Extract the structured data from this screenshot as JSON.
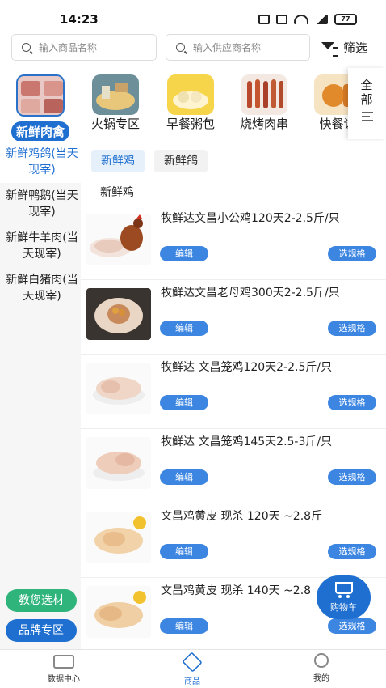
{
  "status_bar": {
    "time": "14:23",
    "battery": "77",
    "icons": [
      "nfc-icon",
      "hd-icon",
      "wifi-icon",
      "signal-icon",
      "battery-icon"
    ]
  },
  "search": {
    "goods_placeholder": "输入商品名称",
    "supplier_placeholder": "输入供应商名称",
    "filter_label": "筛选"
  },
  "categories": [
    {
      "label": "新鲜肉禽",
      "active": true
    },
    {
      "label": "火锅专区",
      "active": false
    },
    {
      "label": "早餐粥包",
      "active": false
    },
    {
      "label": "烧烤肉串",
      "active": false
    },
    {
      "label": "快餐诉",
      "active": false
    }
  ],
  "category_all_label": "全部",
  "sidebar": {
    "items": [
      {
        "label": "新鲜鸡鸽(当天现宰)",
        "active": true
      },
      {
        "label": "新鲜鸭鹅(当天现宰)",
        "active": false
      },
      {
        "label": "新鲜牛羊肉(当天现宰)",
        "active": false
      },
      {
        "label": "新鲜白猪肉(当天现宰)",
        "active": false
      }
    ],
    "guide_button": "教您选材",
    "brand_button": "品牌专区"
  },
  "sub_tabs": [
    {
      "label": "新鲜鸡",
      "active": true
    },
    {
      "label": "新鲜鸽",
      "active": false
    }
  ],
  "section_title": "新鲜鸡",
  "products": [
    {
      "name": "牧鲜达文昌小公鸡120天2-2.5斤/只",
      "edit": "编辑",
      "spec": "选规格"
    },
    {
      "name": "牧鲜达文昌老母鸡300天2-2.5斤/只",
      "edit": "编辑",
      "spec": "选规格"
    },
    {
      "name": "牧鲜达 文昌笼鸡120天2-2.5斤/只",
      "edit": "编辑",
      "spec": "选规格"
    },
    {
      "name": "牧鲜达 文昌笼鸡145天2.5-3斤/只",
      "edit": "编辑",
      "spec": "选规格"
    },
    {
      "name": "文昌鸡黄皮 现杀 120天  ~2.8斤",
      "edit": "编辑",
      "spec": "选规格"
    },
    {
      "name": "文昌鸡黄皮 现杀 140天  ~2.8",
      "edit": "编辑",
      "spec": "选规格"
    }
  ],
  "cart": {
    "label": "购物车"
  },
  "bottom_nav": [
    {
      "label": "数据中心",
      "active": false
    },
    {
      "label": "商品",
      "active": true
    },
    {
      "label": "我的",
      "active": false
    }
  ],
  "colors": {
    "accent": "#1f6fd0",
    "green": "#2fb47c",
    "sidebar_bg": "#f6f6f6"
  }
}
